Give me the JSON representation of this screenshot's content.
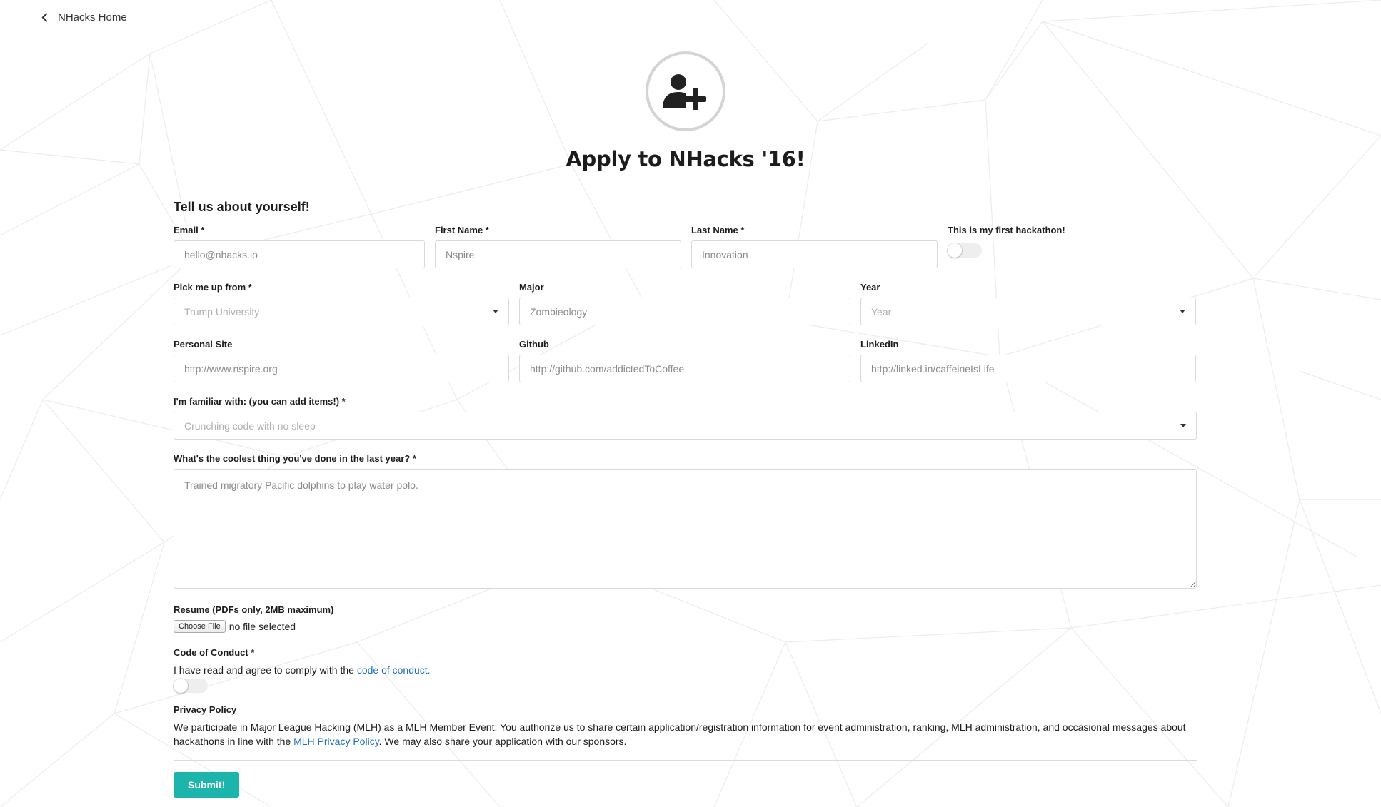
{
  "nav": {
    "home_label": "NHacks Home"
  },
  "header": {
    "title": "Apply to NHacks '16!"
  },
  "form": {
    "section_title": "Tell us about yourself!",
    "email": {
      "label": "Email *",
      "placeholder": "hello@nhacks.io"
    },
    "first_name": {
      "label": "First Name *",
      "placeholder": "Nspire"
    },
    "last_name": {
      "label": "Last Name *",
      "placeholder": "Innovation"
    },
    "first_hackathon": {
      "label": "This is my first hackathon!"
    },
    "pickup": {
      "label": "Pick me up from *",
      "placeholder": "Trump University"
    },
    "major": {
      "label": "Major",
      "placeholder": "Zombieology"
    },
    "year": {
      "label": "Year",
      "placeholder": "Year"
    },
    "personal_site": {
      "label": "Personal Site",
      "placeholder": "http://www.nspire.org"
    },
    "github": {
      "label": "Github",
      "placeholder": "http://github.com/addictedToCoffee"
    },
    "linkedin": {
      "label": "LinkedIn",
      "placeholder": "http://linked.in/caffeineIsLife"
    },
    "familiar": {
      "label": "I'm familiar with: (you can add items!) *",
      "placeholder": "Crunching code with no sleep"
    },
    "coolest": {
      "label": "What's the coolest thing you've done in the last year? *",
      "placeholder": "Trained migratory Pacific dolphins to play water polo."
    },
    "resume": {
      "label": "Resume (PDFs only, 2MB maximum)",
      "button": "Choose File",
      "status": "no file selected"
    },
    "conduct": {
      "label": "Code of Conduct *",
      "text_before": "I have read and agree to comply with the ",
      "link": "code of conduct."
    },
    "privacy": {
      "label": "Privacy Policy",
      "text_before": "We participate in Major League Hacking (MLH) as a MLH Member Event. You authorize us to share certain application/registration information for event administration, ranking, MLH administration, and occasional messages about hackathons in line with the ",
      "link": "MLH Privacy Policy",
      "text_after": ". We may also share your application with our sponsors."
    },
    "submit_label": "Submit!"
  },
  "colors": {
    "accent": "#1cb5ac",
    "link": "#1e70bf"
  }
}
